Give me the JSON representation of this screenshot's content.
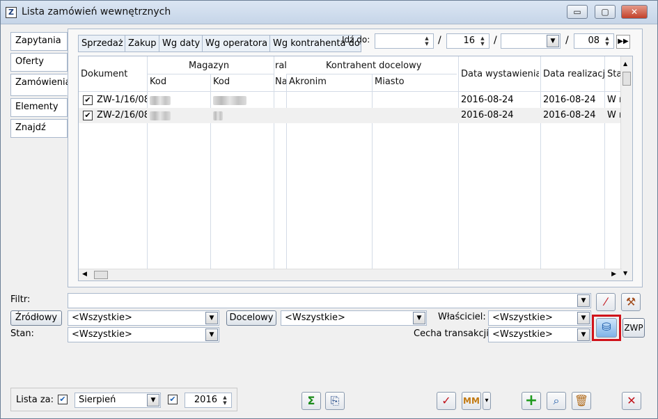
{
  "window": {
    "title": "Lista zamówień wewnętrznych",
    "minimize": "▭",
    "restore": "▢",
    "close": "✕"
  },
  "left_tabs": [
    "Zapytania",
    "Oferty",
    "Zamówienia",
    "Elementy",
    "Znajdź"
  ],
  "top_tabs": [
    "Sprzedaż",
    "Zakup",
    "Wg daty",
    "Wg operatora",
    "Wg kontrahenta doc."
  ],
  "goto": {
    "label": "Idź do:",
    "day": "16",
    "sep": "/",
    "year": "08",
    "nav": "▶▶"
  },
  "grid": {
    "headers": {
      "dokument": "Dokument",
      "magazyn": "Magazyn",
      "kod1": "Kod",
      "kod2": "Kod",
      "ral": "ral",
      "na": "Na",
      "kontrahent": "Kontrahent docelowy",
      "akronim": "Akronim",
      "miasto": "Miasto",
      "data_wyst": "Data wystawienia",
      "data_real": "Data realizacji",
      "stan": "Sta"
    },
    "rows": [
      {
        "dokument": "ZW-1/16/08",
        "data_wyst": "2016-08-24",
        "data_real": "2016-08-24",
        "stan": "W r"
      },
      {
        "dokument": "ZW-2/16/08",
        "data_wyst": "2016-08-24",
        "data_real": "2016-08-24",
        "stan": "W r"
      }
    ]
  },
  "filters": {
    "filtr_label": "Filtr:",
    "zrodlowy_button": "Źródłowy",
    "zrodlowy_value": "<Wszystkie>",
    "docelowy_button": "Docelowy",
    "docelowy_value": "<Wszystkie>",
    "wlasciciel_label": "Właściciel:",
    "wlasciciel_value": "<Wszystkie>",
    "stan_label": "Stan:",
    "stan_value": "<Wszystkie>",
    "cecha_label": "Cecha transakcji:",
    "cecha_value": "<Wszystkie>",
    "zwp_button": "ZWP"
  },
  "footer": {
    "lista_za_label": "Lista za:",
    "month": "Sierpień",
    "year": "2016"
  },
  "colors": {
    "highlight": "#d0121a"
  }
}
